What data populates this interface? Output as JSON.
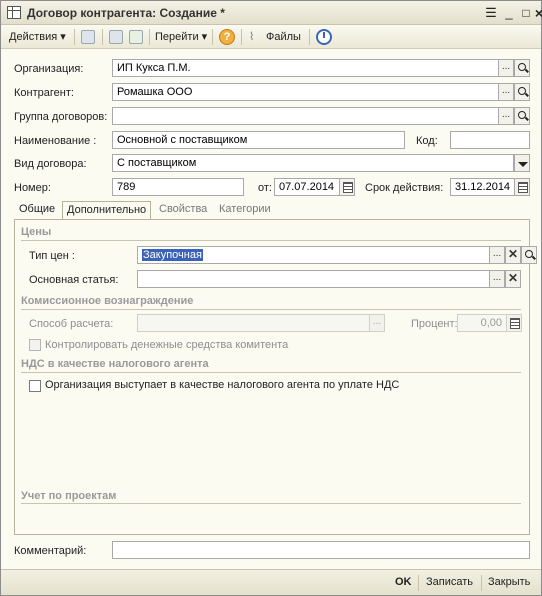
{
  "window": {
    "title": "Договор контрагента: Создание *"
  },
  "toolbar": {
    "actions": "Действия",
    "goto": "Перейти",
    "files": "Файлы",
    "help": "?"
  },
  "form": {
    "org": {
      "label": "Организация:",
      "value": "ИП Кукса П.М."
    },
    "contractor": {
      "label": "Контрагент:",
      "value": "Ромашка ООО"
    },
    "group": {
      "label": "Группа договоров:",
      "value": ""
    },
    "name": {
      "label": "Наименование :",
      "value": "Основной с поставщиком"
    },
    "code": {
      "label": "Код:",
      "value": ""
    },
    "kind": {
      "label": "Вид договора:",
      "value": "С поставщиком"
    },
    "number": {
      "label": "Номер:",
      "value": "789"
    },
    "date": {
      "label": "от:",
      "value": "07.07.2014"
    },
    "term": {
      "label": "Срок действия:",
      "value": "31.12.2014"
    }
  },
  "tabs": [
    "Общие",
    "Дополнительно",
    "Свойства",
    "Категории"
  ],
  "panel": {
    "prices_group": "Цены",
    "price_type": {
      "label": "Тип цен :",
      "value": "Закупочная"
    },
    "main_item": {
      "label": "Основная статья:",
      "value": ""
    },
    "commission_group": "Комиссионное вознаграждение",
    "calc_method": {
      "label": "Способ расчета:",
      "value": ""
    },
    "percent": {
      "label": "Процент:",
      "value": "0,00"
    },
    "control_funds": "Контролировать денежные средства комитента",
    "vat_group": "НДС в качестве налогового агента",
    "vat_agent": "Организация выступает в качестве налогового агента по уплате НДС",
    "projects_group": "Учет по проектам"
  },
  "comment": {
    "label": "Комментарий:",
    "value": ""
  },
  "status": {
    "ok": "OK",
    "save": "Записать",
    "close": "Закрыть"
  },
  "colors": {
    "selection": "#3a62b8",
    "group_text": "#9a9a9a"
  }
}
